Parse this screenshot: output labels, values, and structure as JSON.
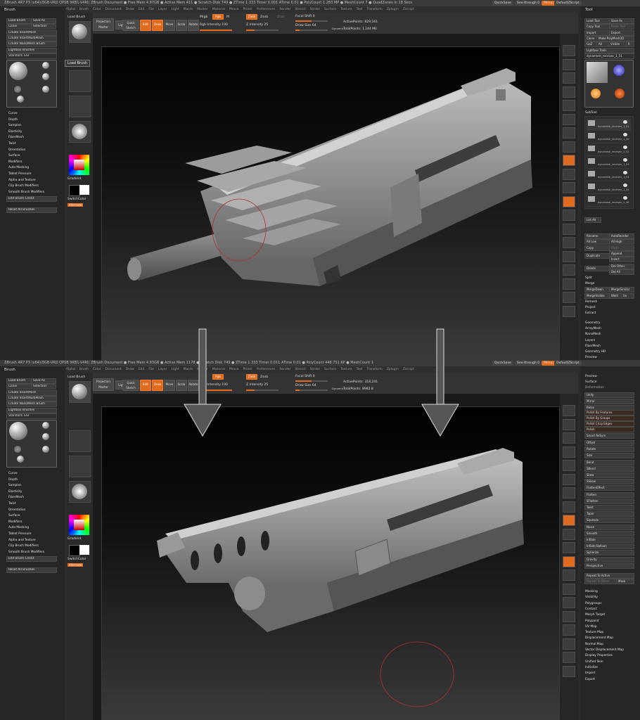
{
  "top": {
    "title": "ZBrush 4R7 P3 (x64)(8GB-VRD QPSB 9KB1-V4RI)   ZBrush Document   ● Free Mem 4.97GB ● Active Mem 411 ● Scratch Disk 749 ● ZTime 1.333 Timer 0.001 ATime 0.01 ● PolyCount 1.283 MP ● MeshCount 7 ● QuadZones In 18 Secs",
    "active_points": "ActivePoints: 829,161",
    "total_points": "TotalPoints: 1.244 Mil"
  },
  "bottom": {
    "title": "ZBrush 4R7 P3 (x64)(8GB-VRD QPSB 9KB1-V4RI)   ZBrush Document   ● Free Mem 4.93GB ● Active Mem 1178 ● Scratch Disk 749 ● ZTime 1.333 Timer 0.011 ATime 0.01 ● PolyCount 448.751 KP ● MeshCount 1",
    "active_points": "ActivePoints: 318,241",
    "total_points": "TotalPoints: 8982.8"
  },
  "menu": [
    "Alpha",
    "Brush",
    "Color",
    "Document",
    "Draw",
    "Edit",
    "File",
    "Layer",
    "Light",
    "Macro",
    "Marker",
    "Material",
    "Movie",
    "Picker",
    "Preferences",
    "Render",
    "Stencil",
    "Stroke",
    "Surface",
    "Texture",
    "Tool",
    "Transform",
    "Zplugin",
    "Zscript"
  ],
  "quicksave": "QuickSave",
  "see_through": "See-through 0",
  "menus_btn": "Menus",
  "default_zscript": "DefaultZScript",
  "brush_panel": {
    "title": "Brush",
    "load_brush": "Load Brush",
    "save_as": "Save As",
    "clone": "Clone",
    "select_btn": "Selection",
    "create_insertmesh": "Create InsertMesh",
    "create_insertmultimesh": "Create InsertMultiMesh",
    "create_nanomesh": "Create NanoMesh Brush",
    "lightbox_brushes": "Lightbox Brushes",
    "current_brush": "Standard. ESF",
    "items": [
      "Curve",
      "Depth",
      "Samples",
      "Elasticity",
      "FiberMesh",
      "Twist",
      "Orientation",
      "Surface",
      "Modifiers",
      "Auto Masking",
      "Tablet Pressure",
      "Alpha and Texture",
      "Clip Brush Modifiers",
      "Smooth Brush Modifiers"
    ],
    "edit_brush_credit": "Edit Brush Credit",
    "reset_all_brushes": "Reset All Brushes"
  },
  "tooltip": "Load Brush",
  "shelf": {
    "load_brush": "Load Brush",
    "gradient": "Gradient",
    "switch_color": "SwitchColor",
    "alternate": "Alternate"
  },
  "topbar": {
    "projection_master": "Projection Master",
    "lightbox": "LightBox",
    "quick_sketch": "Quick Sketch",
    "edit": "Edit",
    "draw": "Draw",
    "move": "Move",
    "scale": "Scale",
    "rotate": "Rotate",
    "mrgb": "Mrgb",
    "rgb": "Rgb",
    "m": "M",
    "zadd": "Zadd",
    "zsub": "Zsub",
    "zcut": "Zcut",
    "rgb_intensity": "Rgb Intensity 100",
    "z_intensity": "Z Intensity 25",
    "focal_shift": "Focal Shift 0",
    "draw_size": "Draw Size 64",
    "dynamic": "Dynamic"
  },
  "right_icons": [
    "BPR",
    "SPix 3",
    "Scroll",
    "Zoom",
    "Actual",
    "AAHalf",
    "Persp",
    "Floor",
    "Local",
    "LSym",
    "Frame",
    "Move",
    "Scale",
    "Rotate",
    "Line Fill",
    "PolyF",
    "Transp",
    "Dynamic",
    "Solo",
    "Xpose"
  ],
  "tool_panel": {
    "title": "Tool",
    "load_tool": "Load Tool",
    "save_as": "Save As",
    "copy_tool": "Copy Tool",
    "paste_tool": "Paste Tool",
    "import": "Import",
    "export": "Export",
    "clone": "Clone",
    "make_polymesh": "Make PolyMesh3D",
    "goz": "GoZ",
    "all": "All",
    "visible": "Visible",
    "r": "R",
    "lightbox_tools": "Lightbox Tools",
    "current_tool": "dynamesh_receiver_1_51",
    "subtool": "SubTool",
    "subtools": [
      "dynamesh_receiver_1_51",
      "dynamesh_receiver_1_50",
      "dynamesh_receiver_1_52",
      "dynamesh_receiver_1_53",
      "dynamesh_receiver_1_54",
      "dynamesh_receiver_1_55",
      "dynamesh_receiver_1_56"
    ],
    "list_all": "List All",
    "rename": "Rename",
    "autoreorder": "AutoReorder",
    "all_low": "All Low",
    "all_high": "All High",
    "copy": "Copy",
    "paste": "Paste",
    "duplicate": "Duplicate",
    "append": "Append",
    "insert": "Insert",
    "delete": "Delete",
    "del_other": "Del Other",
    "del_all": "Del All",
    "split": "Split",
    "merge": "Merge",
    "mergedown": "MergeDown",
    "mergesimilar": "MergeSimilar",
    "mergevisible": "MergeVisible",
    "weld": "Weld",
    "uv": "Uv",
    "remesh": "Remesh",
    "project": "Project",
    "extract": "Extract",
    "sections": [
      "Geometry",
      "ArrayMesh",
      "NanoMesh",
      "Layers",
      "FiberMesh",
      "Geometry HD",
      "Preview"
    ]
  },
  "deform_panel": {
    "preview": "Preview",
    "surface": "Surface",
    "deformation": "Deformation",
    "unify": "Unify",
    "mirror": "Mirror",
    "relax": "Relax",
    "polish_by_features": "Polish By Features",
    "polish_by_groups": "Polish By Groups",
    "polish_crisp_edges": "Polish Crisp Edges",
    "polish": "Polish",
    "smart_resym": "Smart ReSym",
    "deforms": [
      "Offset",
      "Rotate",
      "Size",
      "Bend",
      "SBend",
      "Skew",
      "SSkew",
      "FlattenEffect",
      "Flatten",
      "SFlatten",
      "Twist",
      "Taper",
      "Squeeze",
      "Noise",
      "Smooth",
      "Inflate",
      "Inflate Balloon",
      "Spherize",
      "Gravity",
      "Perspective"
    ],
    "repeat_to_active": "Repeat To Active",
    "repeat_to_other": "Repeat To Other",
    "mask": "Mask",
    "sections": [
      "Masking",
      "Visibility",
      "Polygroups",
      "Contact",
      "Morph Target",
      "Polypaint",
      "UV Map",
      "Texture Map",
      "Displacement Map",
      "Normal Map",
      "Vector Displacement Map",
      "Display Properties",
      "Unified Skin",
      "Initialize",
      "Import",
      "Export"
    ]
  },
  "colors": {
    "accent": "#e06a1d",
    "panel": "#262626",
    "arrow": "#585858"
  }
}
